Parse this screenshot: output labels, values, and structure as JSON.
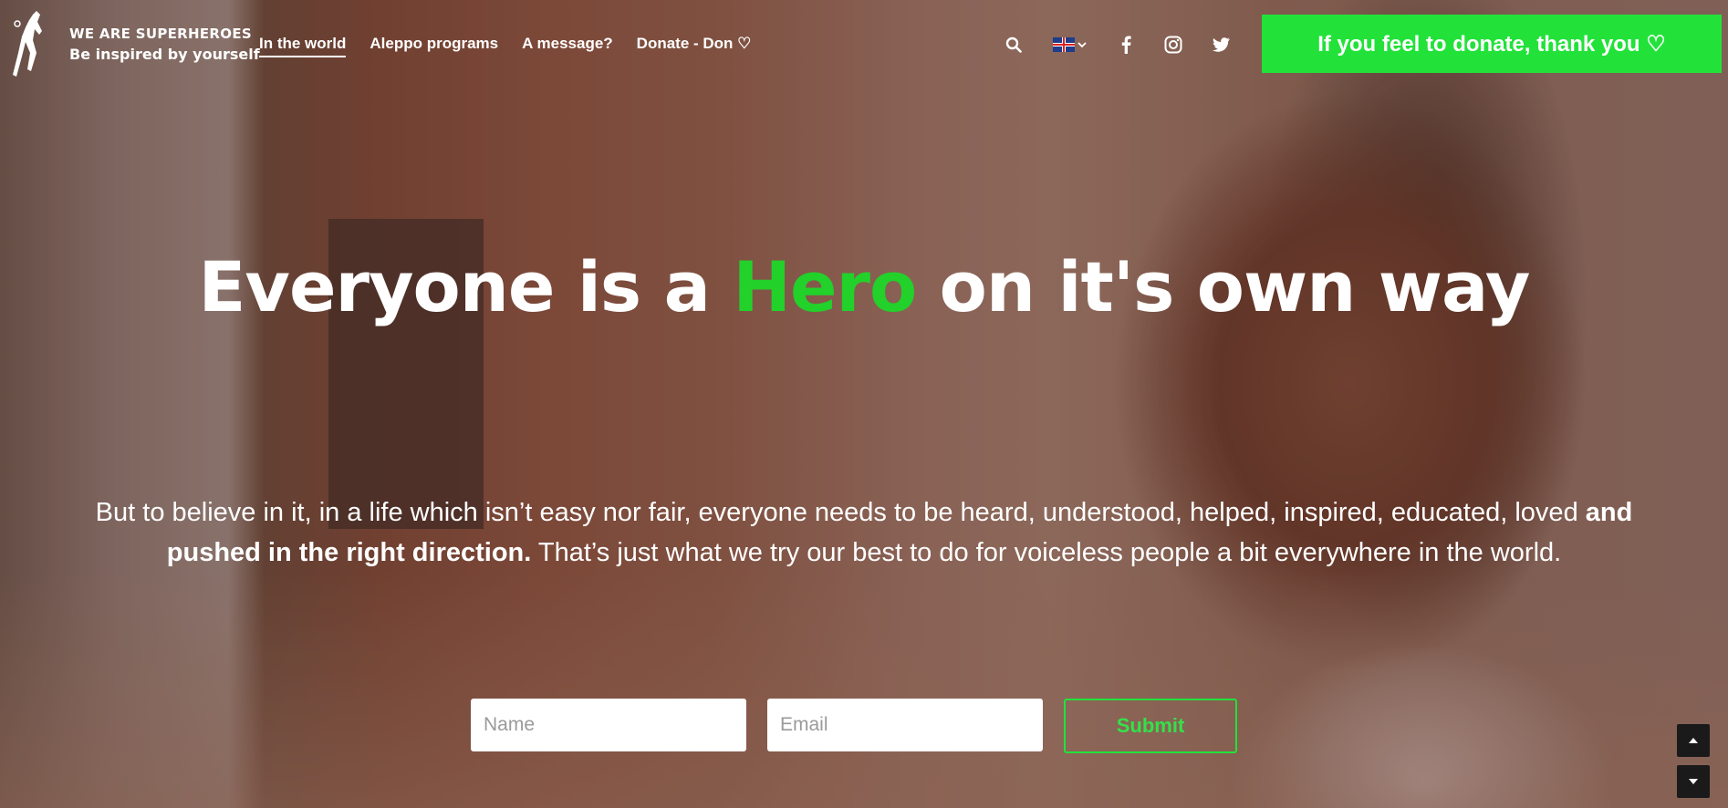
{
  "brand": {
    "name": "WE ARE SUPERHEROES",
    "tagline": "Be inspired by yourself",
    "logo_icon": "superhero-figure-icon"
  },
  "nav": {
    "items": [
      {
        "label": "In the world",
        "active": true
      },
      {
        "label": "Aleppo programs",
        "active": false
      },
      {
        "label": "A message?",
        "active": false
      },
      {
        "label": "Donate - Don ♡",
        "active": false
      }
    ]
  },
  "tools": {
    "search_icon": "search-icon",
    "language_flag": "uk-flag-icon",
    "social": [
      "facebook-icon",
      "instagram-icon",
      "twitter-icon"
    ]
  },
  "donate_button": {
    "label": "If you feel to donate, thank you ♡",
    "color": "#22e23a"
  },
  "hero": {
    "headline_before": "Everyone is a ",
    "headline_highlight": "Hero",
    "headline_after": " on it's own way",
    "highlight_color": "#22d12a",
    "lead_part1": "But to believe in it, in a life which isn’t easy nor fair, everyone needs to be heard, understood, helped, inspired, educated, loved ",
    "lead_bold": "and pushed in the right direction.",
    "lead_part2": " That’s just what we try our best to do for voiceless people a bit everywhere in the world."
  },
  "signup_form": {
    "name_placeholder": "Name",
    "email_placeholder": "Email",
    "submit_label": "Submit"
  },
  "scroll_controls": {
    "up_icon": "arrow-up-icon",
    "down_icon": "arrow-down-icon"
  }
}
